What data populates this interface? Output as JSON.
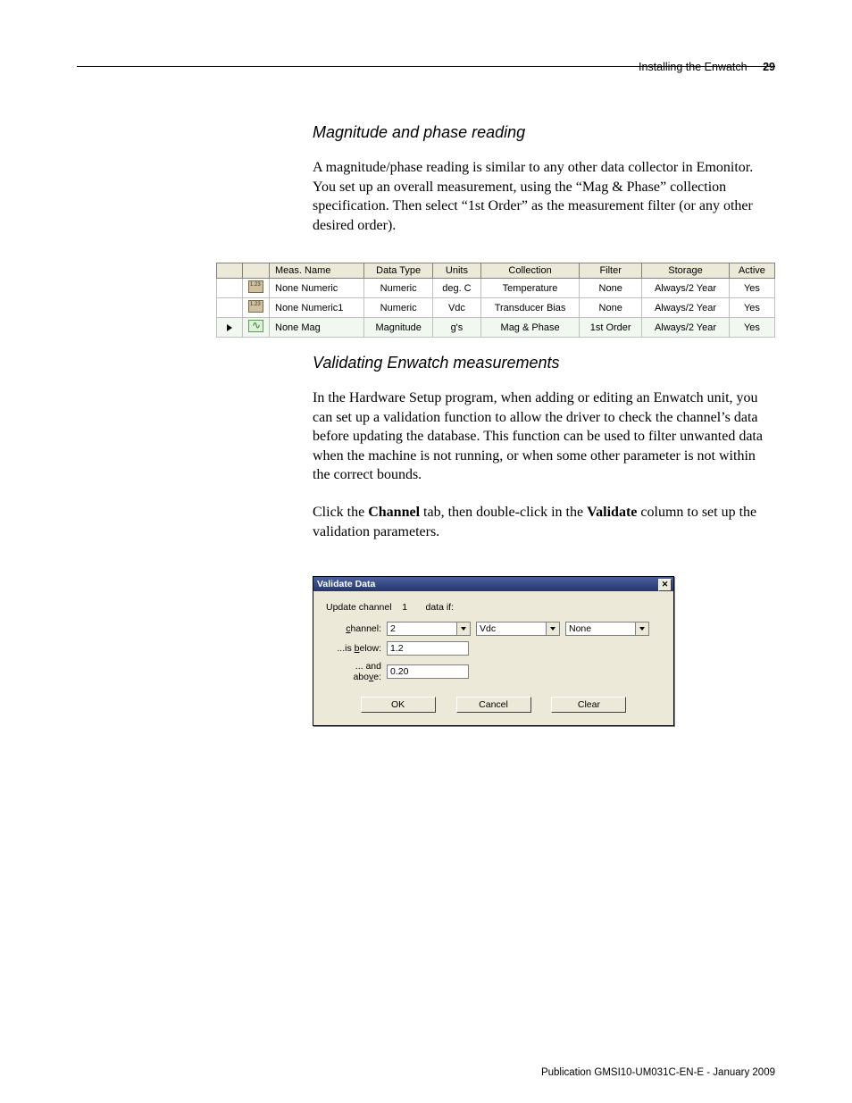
{
  "header": {
    "section": "Installing the Enwatch",
    "page_number": "29"
  },
  "section1": {
    "title": "Magnitude and phase reading",
    "paragraph": "A magnitude/phase reading is similar to any other data collector in Emonitor. You set up an overall measurement, using the “Mag & Phase” collection specification. Then select “1st Order” as the measurement filter (or any other desired order)."
  },
  "meas_table": {
    "headers": [
      "Meas. Name",
      "Data Type",
      "Units",
      "Collection",
      "Filter",
      "Storage",
      "Active"
    ],
    "rows": [
      {
        "icon": "numeric",
        "selected": false,
        "cells": [
          "None Numeric",
          "Numeric",
          "deg. C",
          "Temperature",
          "None",
          "Always/2 Year",
          "Yes"
        ]
      },
      {
        "icon": "numeric",
        "selected": false,
        "cells": [
          "None Numeric1",
          "Numeric",
          "Vdc",
          "Transducer Bias",
          "None",
          "Always/2 Year",
          "Yes"
        ]
      },
      {
        "icon": "wave",
        "selected": true,
        "cells": [
          "None Mag",
          "Magnitude",
          "g's",
          "Mag & Phase",
          "1st Order",
          "Always/2 Year",
          "Yes"
        ]
      }
    ]
  },
  "section2": {
    "title": "Validating Enwatch measurements",
    "para1": "In the Hardware Setup program, when adding or editing an Enwatch unit, you can set up a validation function to allow the driver to check the channel’s data before updating the database. This function can be used to filter unwanted data when the machine is not running, or when some other parameter is not within the correct bounds.",
    "para2_pre": "Click the ",
    "para2_bold1": "Channel",
    "para2_mid": " tab, then double-click in the ",
    "para2_bold2": "Validate",
    "para2_post": " column to set up the validation parameters."
  },
  "dialog": {
    "title": "Validate Data",
    "intro": "Update channel    1       data if:",
    "labels": {
      "channel": "channel:",
      "is_below": "...is below:",
      "and_above": "... and above:"
    },
    "channel_value": "2",
    "combo2_value": "Vdc",
    "combo3_value": "None",
    "is_below_value": "1.2",
    "and_above_value": "0.20",
    "buttons": {
      "ok": "OK",
      "cancel": "Cancel",
      "clear": "Clear"
    }
  },
  "footer": "Publication GMSI10-UM031C-EN-E - January 2009"
}
